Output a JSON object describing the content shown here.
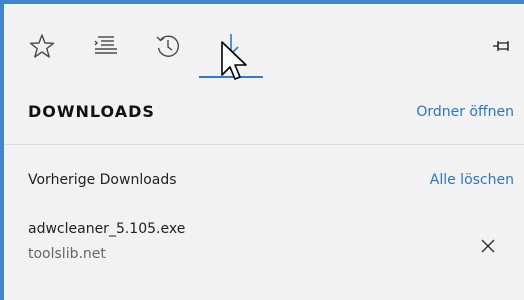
{
  "hub": {
    "active_tab": "downloads",
    "tools": [
      {
        "id": "favorites",
        "icon": "star-icon"
      },
      {
        "id": "reading-list",
        "icon": "reading-list-icon"
      },
      {
        "id": "history",
        "icon": "history-icon"
      },
      {
        "id": "downloads",
        "icon": "download-icon"
      }
    ],
    "pin_icon": "pin-icon",
    "accent_color": "#2f7bd6"
  },
  "downloads_panel": {
    "title": "DOWNLOADS",
    "open_folder_label": "Ordner öffnen",
    "section_label": "Vorherige Downloads",
    "clear_all_label": "Alle löschen",
    "items": [
      {
        "file_name": "adwcleaner_5.105.exe",
        "source": "toolslib.net",
        "remove_icon": "close-icon"
      }
    ]
  }
}
